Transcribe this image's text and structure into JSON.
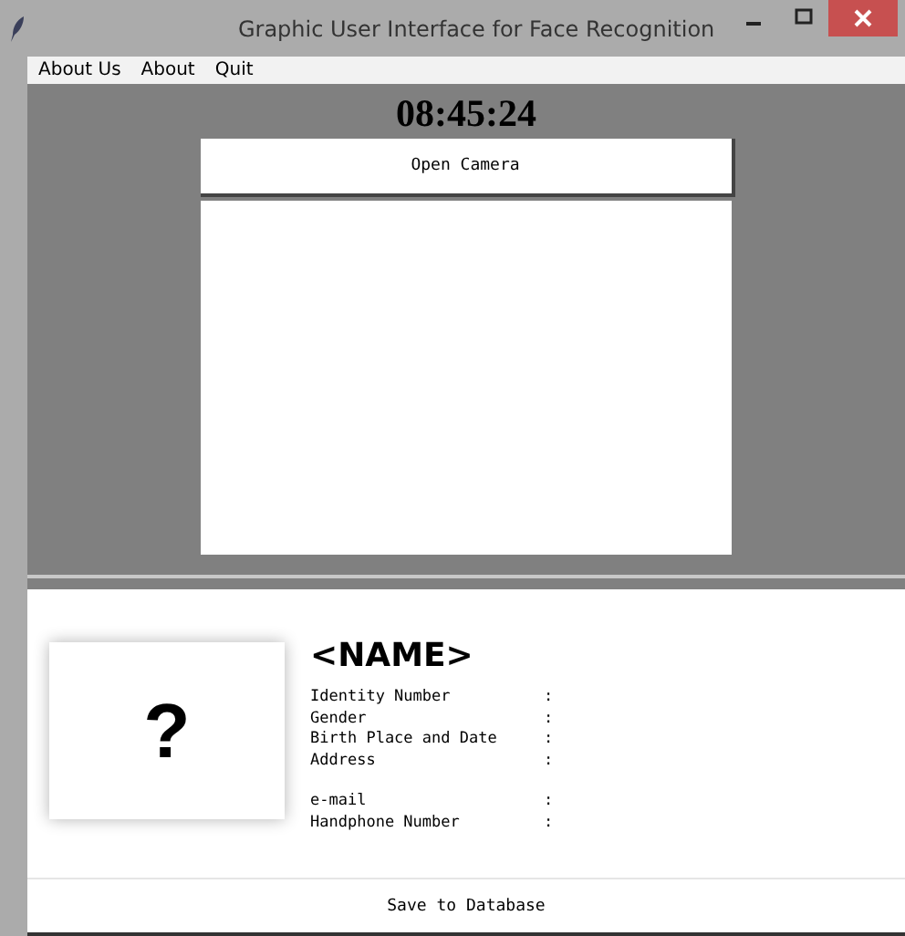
{
  "window": {
    "title": "Graphic User Interface for Face Recognition"
  },
  "menu": [
    "About Us",
    "About",
    "Quit"
  ],
  "clock": "08:45:24",
  "camera_button": "Open Camera",
  "profile": {
    "photo_placeholder": "?",
    "name": "<NAME>",
    "field_groups": [
      [
        {
          "label": "Identity Number",
          "separator": ":"
        },
        {
          "label": "Gender",
          "separator": ":"
        },
        {
          "label": "Birth Place and Date",
          "separator": ":"
        },
        {
          "label": "Address",
          "separator": ":"
        }
      ],
      [
        {
          "label": "e-mail",
          "separator": ":"
        },
        {
          "label": "Handphone Number",
          "separator": ":"
        }
      ]
    ]
  },
  "save_button": "Save to Database"
}
